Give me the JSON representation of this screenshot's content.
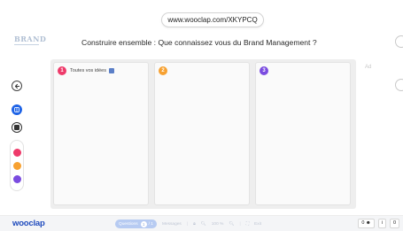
{
  "browser": {
    "url": "www.wooclap.com/XKYPCQ"
  },
  "header": {
    "logo_text": "BRAND",
    "question": "Construire ensemble : Que connaissez vous du Brand Management ?"
  },
  "toolbar": {
    "back_icon": "arrow-left-icon",
    "colors": [
      "#ee3a6a",
      "#f7a131",
      "#7b4ce0"
    ]
  },
  "board": {
    "columns": [
      {
        "number": "1",
        "title": "Toutes vos idées",
        "color": "#ee3a6a"
      },
      {
        "number": "2",
        "title": "",
        "color": "#f7a131"
      },
      {
        "number": "3",
        "title": "",
        "color": "#7b4ce0"
      }
    ],
    "add_column_label": "Ad"
  },
  "footer": {
    "brand": "wooclap",
    "questions_label": "Questions",
    "questions_count": "1",
    "questions_suffix": "/ 1",
    "messages_label": "Messages",
    "zoom": "100 %",
    "exit_label": "Exit",
    "participants": "0",
    "info": "i",
    "extra": "0"
  }
}
